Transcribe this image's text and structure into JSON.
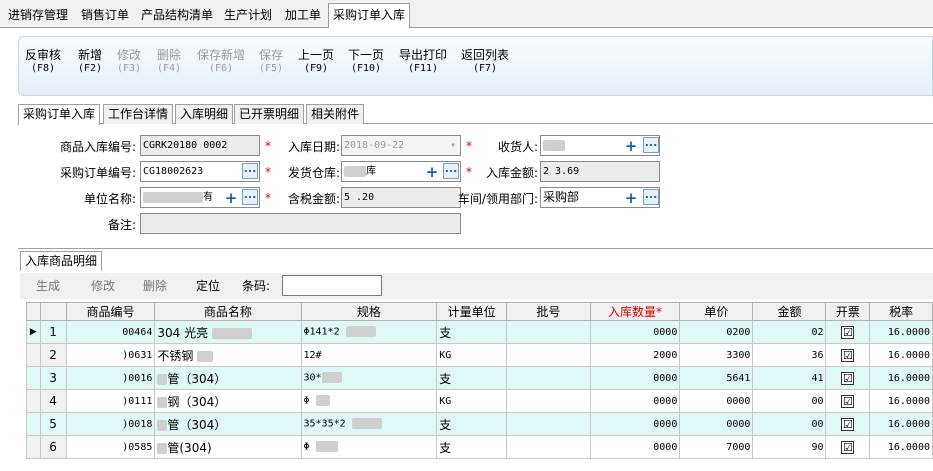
{
  "doc_tabs": [
    "进销存管理",
    "销售订单",
    "产品结构清单",
    "生产计划",
    "加工单",
    "采购订单入库"
  ],
  "toolbar": [
    {
      "label": "反审核",
      "key": "(F8)",
      "enabled": true
    },
    {
      "label": "新增",
      "key": "(F2)",
      "enabled": true
    },
    {
      "label": "修改",
      "key": "(F3)",
      "enabled": false
    },
    {
      "label": "删除",
      "key": "(F4)",
      "enabled": false
    },
    {
      "label": "保存新增",
      "key": "(F6)",
      "enabled": false
    },
    {
      "label": "保存",
      "key": "(F5)",
      "enabled": false
    },
    {
      "label": "上一页",
      "key": "(F9)",
      "enabled": true
    },
    {
      "label": "下一页",
      "key": "(F10)",
      "enabled": true
    },
    {
      "label": "导出打印",
      "key": "(F11)",
      "enabled": true
    },
    {
      "label": "返回列表",
      "key": "(F7)",
      "enabled": true
    }
  ],
  "form_tabs": [
    "采购订单入库",
    "工作台详情",
    "入库明细",
    "已开票明细",
    "相关附件"
  ],
  "form": {
    "receipt_no_label": "商品入库编号:",
    "receipt_no": "CGRK20180   0002",
    "date_label": "入库日期:",
    "date": "2018-09-22",
    "receiver_label": "收货人:",
    "receiver": "",
    "po_no_label": "采购订单编号:",
    "po_no": "CG18002623",
    "warehouse_label": "发货仓库:",
    "warehouse": "库",
    "amount_label": "入库金额:",
    "amount": "2   3.69",
    "unit_label": "单位名称:",
    "unit": "有",
    "tax_amount_label": "含税金额:",
    "tax_amount": "5    .20",
    "dept_label": "车间/领用部门:",
    "dept": "采购部",
    "remark_label": "备注:",
    "remark": "",
    "required_mark": "*"
  },
  "detail": {
    "tab": "入库商品明细",
    "buttons": [
      "生成",
      "修改",
      "删除",
      "定位"
    ],
    "barcode_label": "条码:",
    "columns": [
      "商品编号",
      "商品名称",
      "规格",
      "计量单位",
      "批号",
      "入库数量*",
      "单价",
      "金额",
      "开票",
      "税率"
    ],
    "rows": [
      {
        "no": "1",
        "code": "00464",
        "name": "304 光亮",
        "spec": "Φ141*2",
        "unit": "支",
        "batch": "",
        "qty": "0000",
        "price": "0200",
        "amount": "02",
        "invoice": "☑",
        "tax": "16.0000",
        "current": "▶"
      },
      {
        "no": "2",
        "code": ")0631",
        "name": "不锈钢",
        "spec": "12#",
        "unit": "KG",
        "batch": "",
        "qty": "2000",
        "price": "3300",
        "amount": "36",
        "invoice": "☑",
        "tax": "16.0000",
        "current": ""
      },
      {
        "no": "3",
        "code": ")0016",
        "name": "管（304）",
        "spec": "30*",
        "unit": "支",
        "batch": "",
        "qty": "0000",
        "price": "5641",
        "amount": "41",
        "invoice": "☑",
        "tax": "16.0000",
        "current": ""
      },
      {
        "no": "4",
        "code": ")0111",
        "name": "钢（304）",
        "spec": "Φ",
        "unit": "KG",
        "batch": "",
        "qty": "0000",
        "price": "0000",
        "amount": "00",
        "invoice": "☑",
        "tax": "16.0000",
        "current": ""
      },
      {
        "no": "5",
        "code": ")0018",
        "name": "管（304）",
        "spec": "35*35*2",
        "unit": "支",
        "batch": "",
        "qty": "0000",
        "price": "0000",
        "amount": "00",
        "invoice": "☑",
        "tax": "16.0000",
        "current": ""
      },
      {
        "no": "6",
        "code": ")0585",
        "name": "管(304)",
        "spec": "Φ",
        "unit": "支",
        "batch": "",
        "qty": "0000",
        "price": "7000",
        "amount": "90",
        "invoice": "☑",
        "tax": "16.0000",
        "current": ""
      }
    ]
  }
}
